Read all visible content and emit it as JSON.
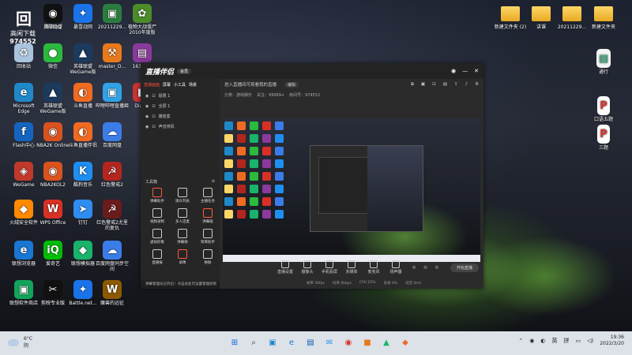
{
  "desktop": {
    "logo": {
      "line1": "回",
      "line2": "高闲下载",
      "number": "974552"
    },
    "left_icons": [
      {
        "label": "腾讯QQ",
        "glyph": "◉",
        "color": "#111"
      },
      {
        "label": "英雄联盟",
        "glyph": "▲",
        "color": "#1b3a5c"
      },
      {
        "label": "暴雪战网",
        "glyph": "✦",
        "color": "#1a73e8"
      },
      {
        "label": "20211229...",
        "glyph": "▣",
        "color": "#2a7d3e"
      },
      {
        "label": "植物大战僵尸 2010年度版",
        "glyph": "✿",
        "color": "#4d8c2a"
      },
      {
        "label": "回收站",
        "glyph": "♻",
        "color": "#a9c4dd"
      },
      {
        "label": "微信",
        "glyph": "●",
        "color": "#2bba3d"
      },
      {
        "label": "英雄联盟 WeGame版",
        "glyph": "▲",
        "color": "#1b3a5c"
      },
      {
        "label": "master_D...",
        "glyph": "⚒",
        "color": "#e8791c"
      },
      {
        "label": "163ui-...",
        "glyph": "▤",
        "color": "#8a3a9c"
      },
      {
        "label": "Microsoft Edge",
        "glyph": "e",
        "color": "#1e88c8"
      },
      {
        "label": "英雄联盟 WeGame版",
        "glyph": "▲",
        "color": "#1b3a5c"
      },
      {
        "label": "斗鱼直播",
        "glyph": "◐",
        "color": "#f06a22"
      },
      {
        "label": "哔哩哔哩直播姬",
        "glyph": "▣",
        "color": "#2fa3e6"
      },
      {
        "label": "Diag...",
        "glyph": "■",
        "color": "#c33"
      },
      {
        "label": "Flash中心",
        "glyph": "f",
        "color": "#1565c0"
      },
      {
        "label": "NBA2K Online",
        "glyph": "◉",
        "color": "#d9531e"
      },
      {
        "label": "斗鱼直播伴侣",
        "glyph": "◐",
        "color": "#f06a22"
      },
      {
        "label": "百度网盘",
        "glyph": "☁",
        "color": "#3b7de8"
      },
      {
        "label": "WeGame",
        "glyph": "◈",
        "color": "#c0392b"
      },
      {
        "label": "NBA2KOL2",
        "glyph": "◉",
        "color": "#d9531e"
      },
      {
        "label": "酷狗音乐",
        "glyph": "K",
        "color": "#1f8ef1"
      },
      {
        "label": "红色警戒2",
        "glyph": "☭",
        "color": "#b3261e"
      },
      {
        "label": "火绒安全软件",
        "glyph": "◆",
        "color": "#ff8a00"
      },
      {
        "label": "WPS Office",
        "glyph": "W",
        "color": "#d93025"
      },
      {
        "label": "钉钉",
        "glyph": "➤",
        "color": "#2f8cf0"
      },
      {
        "label": "红色警戒2尤里的复仇",
        "glyph": "☭",
        "color": "#6a1b1b"
      },
      {
        "label": "联想浏览器",
        "glyph": "e",
        "color": "#1976d2"
      },
      {
        "label": "爱奇艺",
        "glyph": "iQ",
        "color": "#00be06"
      },
      {
        "label": "联想模拟器",
        "glyph": "◆",
        "color": "#19b36b"
      },
      {
        "label": "百度网盘同步空间",
        "glyph": "☁",
        "color": "#3b7de8"
      },
      {
        "label": "联想软件商店",
        "glyph": "▣",
        "color": "#13a35b"
      },
      {
        "label": "剪映专业版",
        "glyph": "✂",
        "color": "#111"
      },
      {
        "label": "Battle.net...",
        "glyph": "✦",
        "color": "#1a73e8"
      },
      {
        "label": "魔兽的远征",
        "glyph": "W",
        "color": "#8b5a00"
      }
    ],
    "right_icons": [
      {
        "label": "新建文件夹 (2)",
        "type": "folder"
      },
      {
        "label": "讲课",
        "type": "folder"
      },
      {
        "label": "20211229...",
        "type": "folder"
      },
      {
        "label": "新建文件夹",
        "type": "folder"
      },
      {
        "label": "通行",
        "type": "file"
      },
      {
        "label": "口语五题",
        "type": "pdf"
      },
      {
        "label": "三题",
        "type": "pdf"
      }
    ]
  },
  "app": {
    "brand": "直播伴侣",
    "badge": "会员",
    "tabs": [
      "直播画面",
      "屏幕",
      "小工具",
      "场景"
    ],
    "scenes": [
      "极限 1",
      "全屏 1",
      "播放盒",
      "声音排风"
    ],
    "tools_header": "工具箱",
    "tools": [
      "弹幕助手",
      "观众列表",
      "主播任务",
      "视频录制",
      "多人连麦",
      "弹幕碰",
      "虚拟形象",
      "弹幕微",
      "贺库助手",
      "直播报",
      "录像",
      "换肤"
    ],
    "notice": "弹幕管理员已开启！点击此处可设置管理权限",
    "room_title": "进入直播间可观看我的直播",
    "room_edit": "编辑",
    "sub_info": [
      "分类：游戏娱乐",
      "关注：99999+",
      "房间号：974552"
    ],
    "controls": [
      "直播设置",
      "摄像头",
      "手机投屏",
      "多媒体",
      "麦克风",
      "扬声器"
    ],
    "golive": "开始直播",
    "stats": [
      "帧率 30fps",
      "码率 0kbps",
      "CPU 25%",
      "丢帧 0%",
      "延迟 0ms"
    ]
  },
  "taskbar": {
    "weather_temp": "6°C",
    "weather_desc": "阴",
    "apps": [
      "⊞",
      "⌕",
      "▣",
      "e",
      "▤",
      "✉",
      "◉",
      "■",
      "▲",
      "◆"
    ],
    "ime1": "英",
    "ime2": "拼",
    "time": "19:36",
    "date": "2022/3/20"
  }
}
